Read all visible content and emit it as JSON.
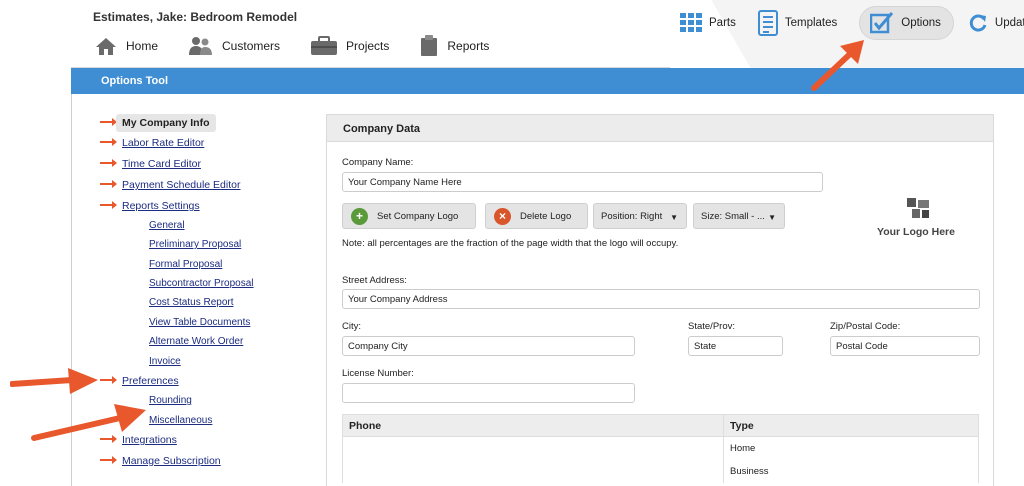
{
  "project_title": "Estimates, Jake: Bedroom Remodel",
  "nav": {
    "home": "Home",
    "customers": "Customers",
    "projects": "Projects",
    "reports": "Reports"
  },
  "toolbar": {
    "parts": "Parts",
    "templates": "Templates",
    "options": "Options",
    "update": "Update"
  },
  "section_bar": "Options Tool",
  "sidebar": {
    "my_company_info": "My Company Info",
    "labor_rate_editor": "Labor Rate Editor",
    "time_card_editor": "Time Card Editor",
    "payment_schedule_editor": "Payment Schedule Editor",
    "reports_settings": "Reports Settings",
    "report_subitems": [
      "General",
      "Preliminary Proposal",
      "Formal Proposal",
      "Subcontractor Proposal",
      "Cost Status Report",
      "View Table Documents",
      "Alternate Work Order",
      "Invoice"
    ],
    "preferences": "Preferences",
    "preference_subitems": [
      "Rounding",
      "Miscellaneous"
    ],
    "integrations": "Integrations",
    "manage_subscription": "Manage Subscription"
  },
  "panel": {
    "title": "Company Data",
    "company_name_label": "Company Name:",
    "company_name_value": "Your Company Name Here",
    "set_logo": "Set Company Logo",
    "delete_logo": "Delete Logo",
    "position_select": "Position: Right",
    "size_select": "Size: Small - ...",
    "logo_placeholder": "Your Logo Here",
    "note": "Note: all percentages are the fraction of the page width that the logo will occupy.",
    "street_label": "Street Address:",
    "street_value": "Your Company Address",
    "city_label": "City:",
    "city_value": "Company City",
    "state_label": "State/Prov:",
    "state_value": "State",
    "zip_label": "Zip/Postal Code:",
    "zip_value": "Postal Code",
    "license_label": "License Number:",
    "license_value": "",
    "phone_table": {
      "headers": [
        "Phone",
        "Type"
      ],
      "types": [
        "Home",
        "Business"
      ]
    }
  },
  "colors": {
    "accent_blue": "#3f8ed4",
    "arrow_red": "#e8582c",
    "link_blue": "#1c2c80"
  }
}
